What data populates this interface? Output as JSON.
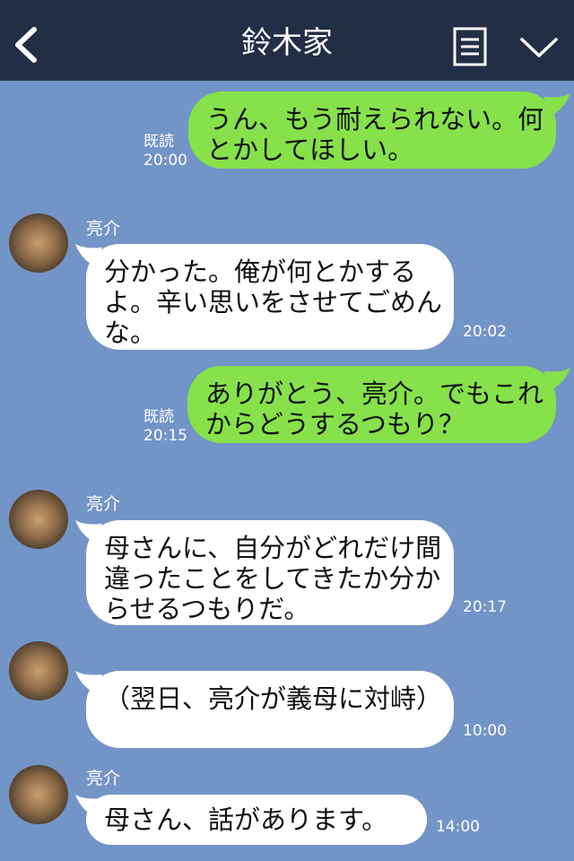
{
  "header": {
    "title": "鈴木家"
  },
  "messages": [
    {
      "side": "right",
      "text": "うん、もう耐えられない。何とかしてほしい。",
      "read_label": "既読",
      "time": "20:00"
    },
    {
      "side": "left",
      "sender": "亮介",
      "text": "分かった。俺が何とかするよ。辛い思いをさせてごめんな。",
      "time": "20:02"
    },
    {
      "side": "right",
      "text": "ありがとう、亮介。でもこれからどうするつもり？",
      "read_label": "既読",
      "time": "20:15"
    },
    {
      "side": "left",
      "sender": "亮介",
      "text": "母さんに、自分がどれだけ間違ったことをしてきたか分からせるつもりだ。",
      "time": "20:17"
    },
    {
      "side": "left",
      "sender": "",
      "text": "（翌日、亮介が義母に対峙）",
      "time": "10:00"
    },
    {
      "side": "left",
      "sender": "亮介",
      "text": "母さん、話があります。",
      "time": "14:00"
    }
  ],
  "colors": {
    "background": "#7394c6",
    "header": "#222e46",
    "bubble_mine": "#86e14a",
    "bubble_other": "#ffffff"
  },
  "icons": {
    "back": "chevron-left-icon",
    "memo": "note-icon",
    "menu": "chevron-down-icon"
  }
}
